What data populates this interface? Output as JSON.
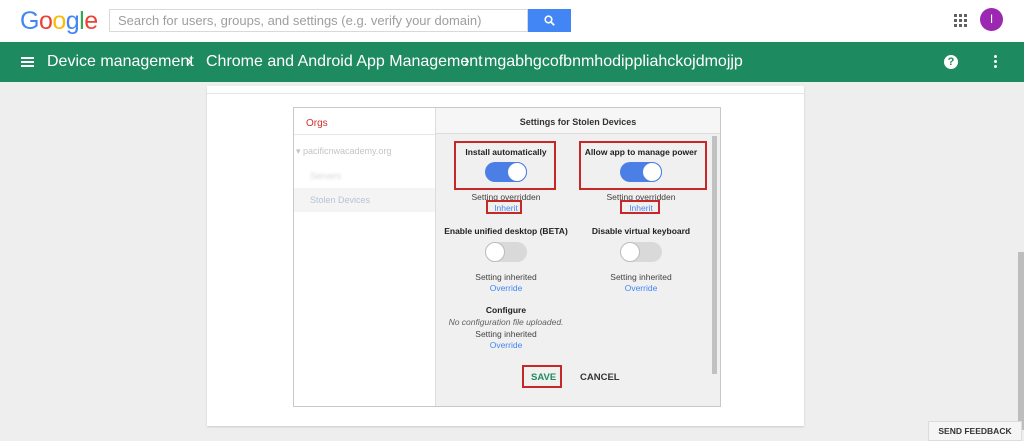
{
  "logo": {
    "letters": [
      "G",
      "o",
      "o",
      "g",
      "l",
      "e"
    ],
    "colors": [
      "#4285f4",
      "#ea4335",
      "#fbbc05",
      "#4285f4",
      "#34a853",
      "#ea4335"
    ]
  },
  "search": {
    "placeholder": "Search for users, groups, and settings (e.g. verify your domain)"
  },
  "user": {
    "avatar_initial": "I",
    "avatar_color": "#9c27b0"
  },
  "breadcrumb": {
    "items": [
      "Device management",
      "Chrome and Android App Management",
      "mgabhgcofbnmhodippliahckojdmojjp"
    ],
    "separator": "›"
  },
  "orgs": {
    "label": "Orgs",
    "root": "▾ pacificnwacademy.org",
    "child_blurred": "Servers",
    "selected": "Stolen Devices"
  },
  "settings_panel": {
    "header": "Settings for Stolen Devices",
    "install_automatically": {
      "title": "Install automatically",
      "enabled": true,
      "status": "Setting overridden",
      "action": "Inherit"
    },
    "manage_power": {
      "title": "Allow app to manage power",
      "enabled": true,
      "status": "Setting overridden",
      "action": "Inherit"
    },
    "unified_desktop": {
      "title": "Enable unified desktop (BETA)",
      "enabled": false,
      "status": "Setting inherited",
      "action": "Override"
    },
    "virtual_keyboard": {
      "title": "Disable virtual keyboard",
      "enabled": false,
      "status": "Setting inherited",
      "action": "Override"
    },
    "configure": {
      "title": "Configure",
      "note": "No configuration file uploaded.",
      "status": "Setting inherited",
      "action": "Override"
    },
    "save_label": "SAVE",
    "cancel_label": "CANCEL"
  },
  "feedback_label": "SEND FEEDBACK",
  "colors": {
    "nav_green": "#1e8a5f",
    "accent_blue": "#4285f4",
    "highlight_red": "#c62828"
  }
}
